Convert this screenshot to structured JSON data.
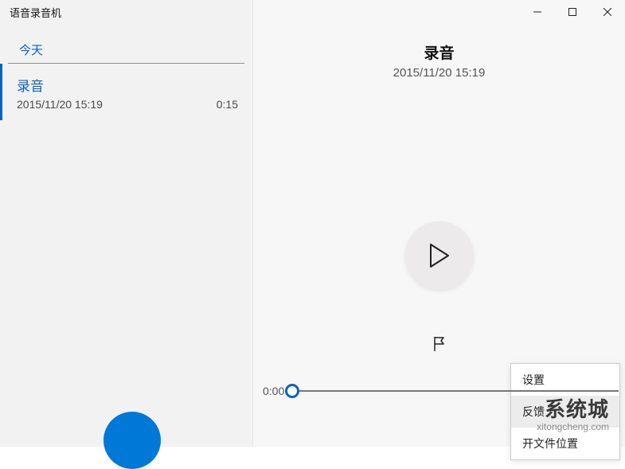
{
  "app": {
    "title": "语音录音机"
  },
  "sidebar": {
    "section": "今天",
    "items": [
      {
        "name": "录音",
        "datetime": "2015/11/20 15:19",
        "duration": "0:15"
      }
    ]
  },
  "detail": {
    "title": "录音",
    "datetime": "2015/11/20 15:19"
  },
  "timeline": {
    "start": "0:00"
  },
  "menu": {
    "items": [
      "设置",
      "反馈",
      "开文件位置"
    ]
  },
  "watermark": {
    "cn": "系统城",
    "en": "xitongcheng.com"
  }
}
